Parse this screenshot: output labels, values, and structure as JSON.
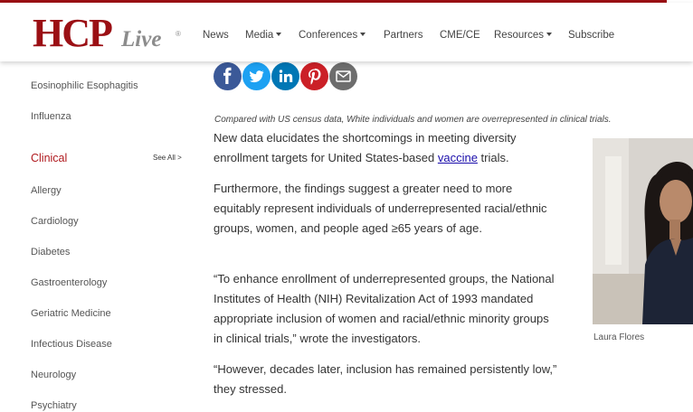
{
  "brand": {
    "name_main": "HCP",
    "name_live": "Live",
    "reg": "®"
  },
  "nav": {
    "news": "News",
    "media": "Media",
    "conferences": "Conferences",
    "partners": "Partners",
    "cme": "CME/CE",
    "resources": "Resources",
    "subscribe": "Subscribe"
  },
  "sidebar": {
    "top_items": [
      "Eosinophilic Esophagitis",
      "Influenza"
    ],
    "section_title": "Clinical",
    "see_all": "See All >",
    "items": [
      "Allergy",
      "Cardiology",
      "Diabetes",
      "Gastroenterology",
      "Geriatric Medicine",
      "Infectious Disease",
      "Neurology",
      "Psychiatry"
    ]
  },
  "share": {
    "colors": {
      "facebook": "#3b5998",
      "twitter": "#1da1f2",
      "linkedin": "#0077b5",
      "pinterest": "#cb2027",
      "email": "#6d6d6d"
    }
  },
  "article": {
    "caption": "Compared with US census data, White individuals and women are overrepresented in clinical trials.",
    "p1_before": "New data elucidates the shortcomings in meeting diversity enrollment targets for United States-based ",
    "p1_link": "vaccine",
    "p1_after": " trials.",
    "p2": "Furthermore, the findings suggest a greater need to more equitably represent individuals of underrepresented racial/ethnic groups, women, and people aged ≥65 years of age.",
    "p3": "“To enhance enrollment of underrepresented groups, the National Institutes of Health (NIH) Revitalization Act of 1993 mandated appropriate inclusion of women and racial/ethnic minority groups in clinical trials,” wrote the investigators.",
    "p4": "“However, decades later, inclusion has remained persistently low,” they stressed.",
    "author_caption": "Laura Flores"
  }
}
